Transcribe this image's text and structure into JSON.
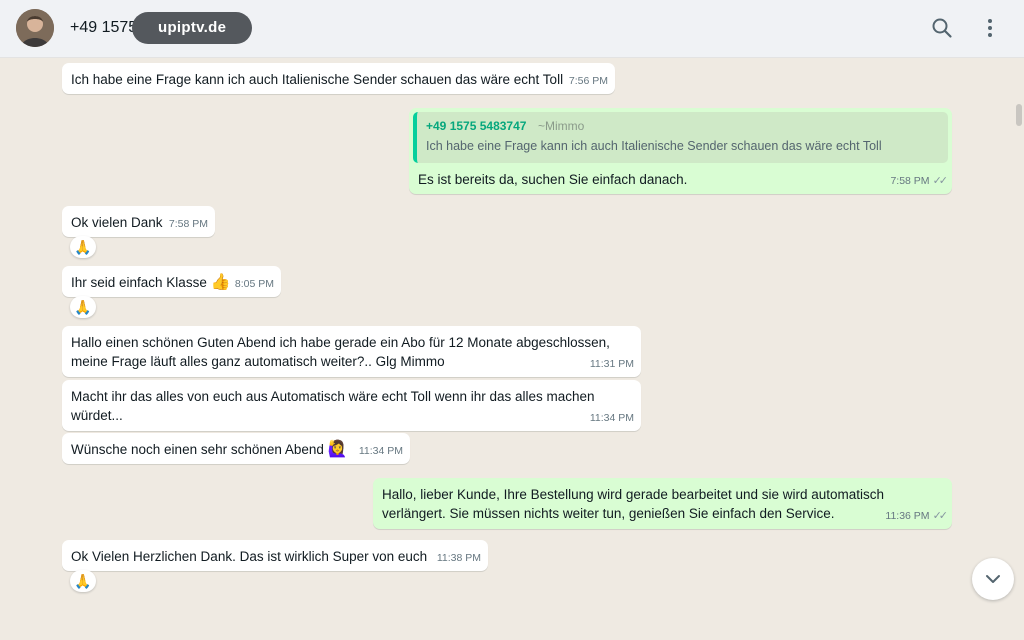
{
  "header": {
    "contact_name": "+49 1575",
    "watermark": "upiptv.de",
    "search_icon": "search-icon",
    "menu_icon": "kebab-menu-icon"
  },
  "messages": [
    {
      "dir": "in",
      "text": "Ich habe eine Frage kann ich auch Italienische Sender schauen das wäre echt Toll",
      "time": "7:56 PM"
    },
    {
      "dir": "out",
      "quote": {
        "name": "+49 1575 5483747",
        "alias": "~Mimmo",
        "text": "Ich habe eine Frage kann ich auch Italienische Sender schauen das wäre echt Toll"
      },
      "text": "Es ist bereits da, suchen Sie einfach danach.",
      "time": "7:58 PM"
    },
    {
      "dir": "in",
      "text": "Ok vielen Dank",
      "time": "7:58 PM",
      "reaction": "🙏"
    },
    {
      "dir": "in",
      "text": "Ihr seid einfach Klasse",
      "emoji": "👍",
      "time": "8:05 PM",
      "reaction": "🙏"
    },
    {
      "dir": "in",
      "text": "Hallo einen schönen Guten Abend ich habe gerade ein Abo für 12 Monate abgeschlossen,\nmeine Frage läuft alles ganz automatisch weiter?.. Glg Mimmo",
      "time": "11:31 PM"
    },
    {
      "dir": "in",
      "text": "Macht ihr das alles von euch aus Automatisch wäre echt Toll wenn ihr das alles machen\nwürdet...",
      "time": "11:34 PM"
    },
    {
      "dir": "in",
      "text": "Wünsche noch einen sehr schönen Abend",
      "emoji": "🙋‍♀️",
      "time": "11:34 PM"
    },
    {
      "dir": "out",
      "text": "Hallo, lieber Kunde, Ihre Bestellung wird gerade bearbeitet und sie wird automatisch\nverlängert. Sie müssen nichts weiter tun, genießen Sie einfach den Service.",
      "time": "11:36 PM"
    },
    {
      "dir": "in",
      "text": "Ok Vielen Herzlichen Dank. Das ist wirklich Super von euch",
      "time": "11:38 PM",
      "reaction": "🙏"
    }
  ],
  "colors": {
    "chat_bg": "#efeae2",
    "incoming": "#ffffff",
    "outgoing": "#d9fdd3",
    "quote_bar": "#06cf9c"
  },
  "scroll_down_icon": "chevron-down-icon"
}
